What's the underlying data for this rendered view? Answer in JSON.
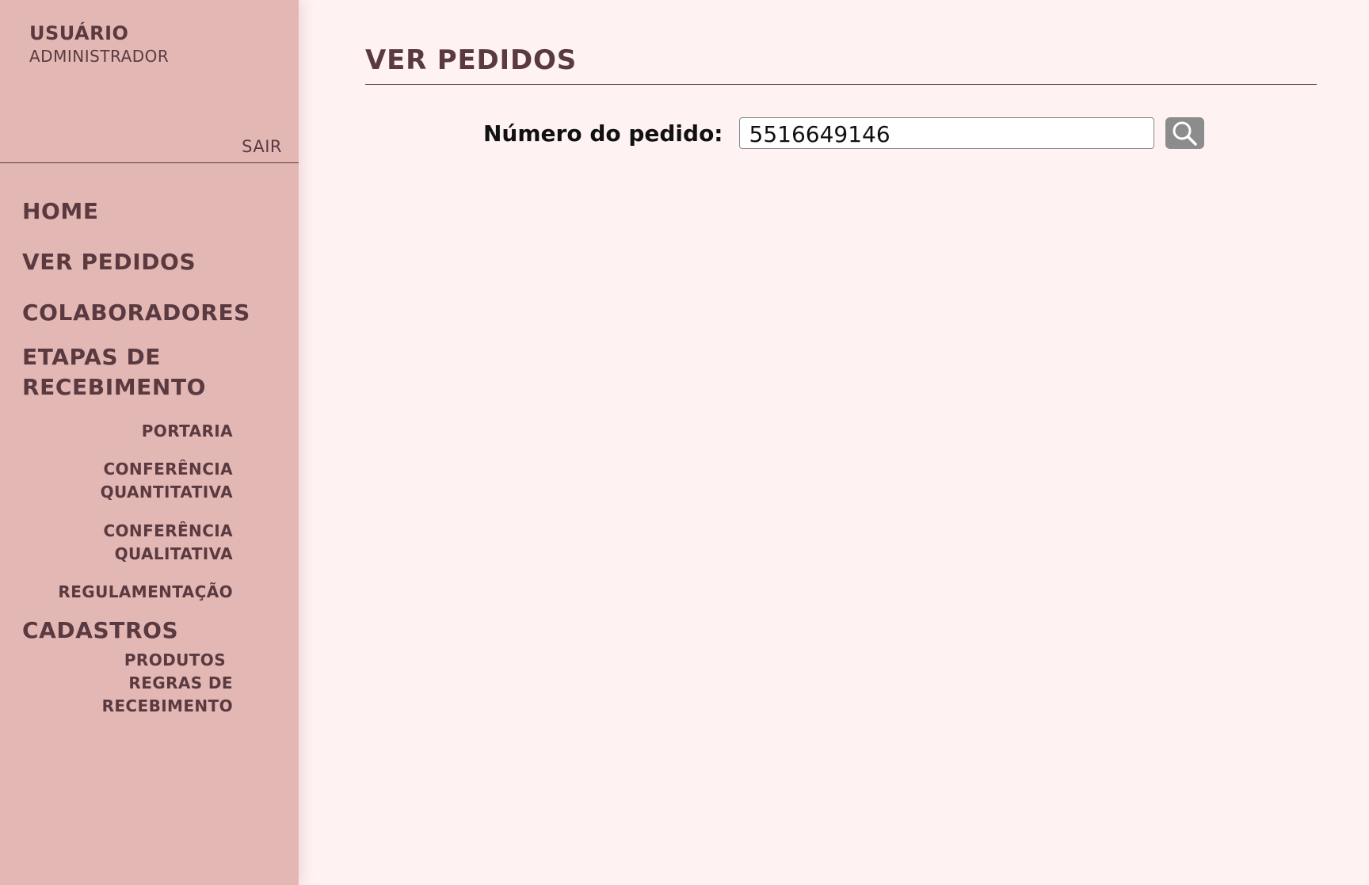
{
  "user": {
    "title": "USUÁRIO",
    "role": "ADMINISTRADOR",
    "logout_label": "SAIR"
  },
  "nav": {
    "home": "HOME",
    "ver_pedidos": "VER PEDIDOS",
    "colaboradores": "COLABORADORES",
    "etapas_line1": "ETAPAS DE",
    "etapas_line2": "RECEBIMENTO",
    "portaria": "PORTARIA",
    "conf_quant_line1": "CONFERÊNCIA",
    "conf_quant_line2": "QUANTITATIVA",
    "conf_qual_line1": "CONFERÊNCIA",
    "conf_qual_line2": "QUALITATIVA",
    "regulamentacao": "REGULAMENTAÇÃO",
    "cadastros": "CADASTROS",
    "produtos": "PRODUTOS",
    "regras_line1": "REGRAS DE",
    "regras_line2": "RECEBIMENTO"
  },
  "main": {
    "title": "VER PEDIDOS",
    "search_label": "Número do pedido:",
    "search_value": "5516649146",
    "search_icon": "search-icon"
  },
  "colors": {
    "sidebar_bg": "#e3b8b4",
    "page_bg": "#fef3f2",
    "text_accent": "#5a3a40",
    "button_bg": "#8c8c8c"
  }
}
